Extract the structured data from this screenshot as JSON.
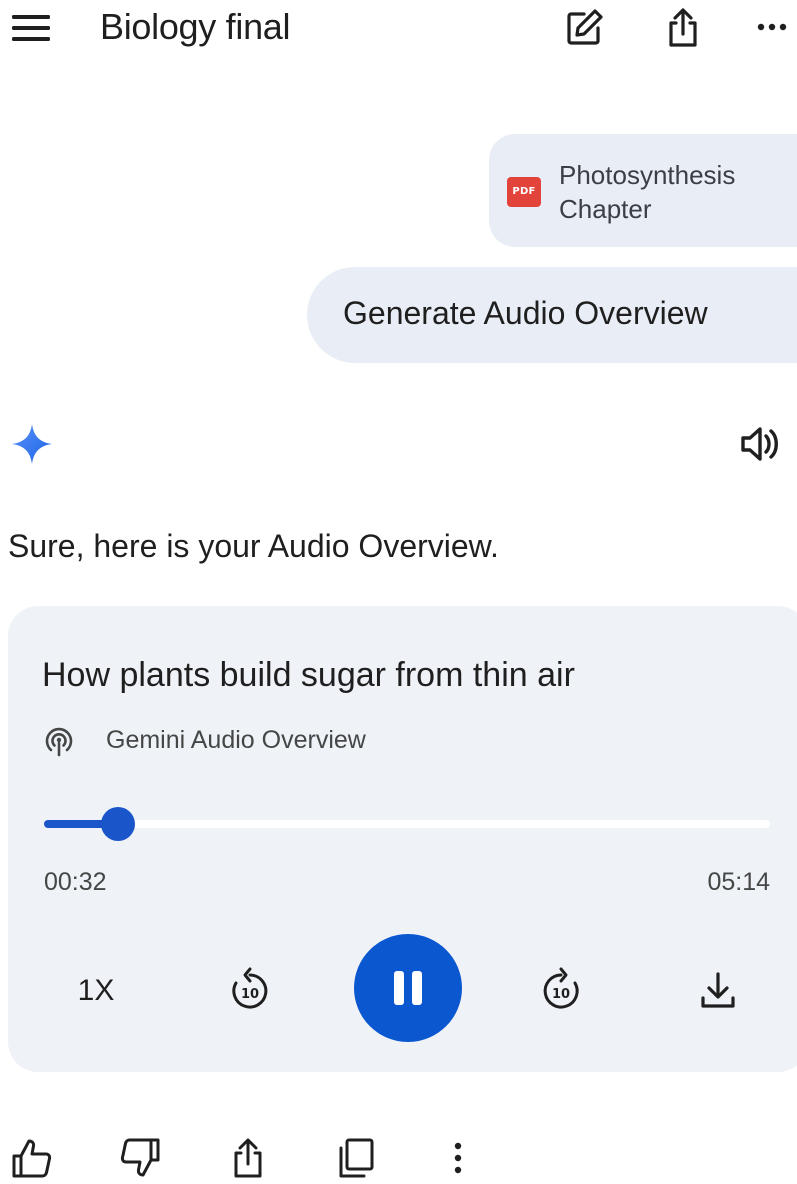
{
  "header": {
    "title": "Biology final",
    "menu_icon": "hamburger-menu-icon",
    "edit_icon": "edit-chat-icon",
    "share_icon": "share-icon",
    "more_icon": "more-horiz-icon"
  },
  "user_messages": {
    "attachment": {
      "type_label": "PDF",
      "name": "Photosynthesis Chapter",
      "icon": "pdf-file-icon"
    },
    "prompt": "Generate Audio Overview"
  },
  "response": {
    "assistant_icon": "gemini-spark-icon",
    "speaker_icon": "read-aloud-speaker-icon",
    "text": "Sure, here is your Audio Overview."
  },
  "audio_player": {
    "title": "How plants build sugar from thin air",
    "source_icon": "podcast-icon",
    "source_label": "Gemini Audio Overview",
    "elapsed": "00:32",
    "duration": "05:14",
    "progress_fraction": 0.102,
    "speed_label": "1X",
    "rewind_icon": "replay-10-icon",
    "play_state": "playing",
    "pause_icon": "pause-icon",
    "forward_icon": "forward-10-icon",
    "download_icon": "download-icon",
    "skip_label": "10"
  },
  "feedback_actions": [
    {
      "name": "thumbs-up-icon"
    },
    {
      "name": "thumbs-down-icon"
    },
    {
      "name": "share-icon"
    },
    {
      "name": "copy-icon"
    },
    {
      "name": "more-vert-icon"
    }
  ],
  "colors": {
    "accent": "#0b57d0",
    "bubble": "#e9eef6",
    "card": "#eff2f7",
    "pdf_red": "#e2433a"
  }
}
